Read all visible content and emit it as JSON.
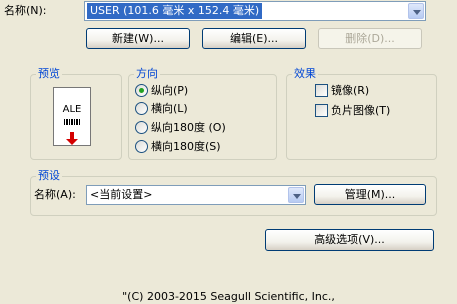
{
  "stock": {
    "name_label": "名称(N):",
    "value": "USER (101.6 毫米 x 152.4 毫米)",
    "buttons": {
      "new": "新建(W)...",
      "edit": "编辑(E)...",
      "delete": "删除(D)..."
    }
  },
  "preview": {
    "title": "预览",
    "label_text": "ALE"
  },
  "orientation": {
    "title": "方向",
    "options": [
      "纵向(P)",
      "横向(L)",
      "纵向180度 (O)",
      "横向180度(S)"
    ],
    "selected": "纵向(P)"
  },
  "effects": {
    "title": "效果",
    "options": [
      {
        "label": "镜像(R)",
        "checked": false
      },
      {
        "label": "负片图像(T)",
        "checked": false
      }
    ]
  },
  "presets": {
    "title": "预设",
    "name_label": "名称(A):",
    "value": "<当前设置>",
    "manage_button": "管理(M)..."
  },
  "advanced_button": "高级选项(V)...",
  "copyright": "\"(C) 2003-2015 Seagull Scientific, Inc.,"
}
